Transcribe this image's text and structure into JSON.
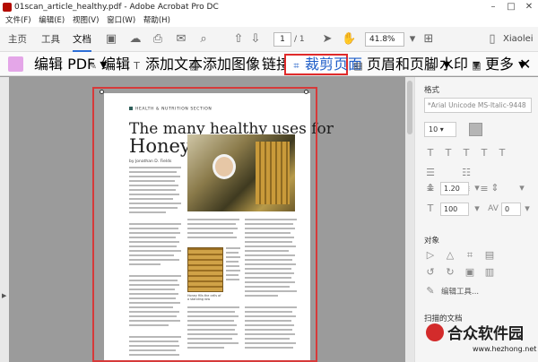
{
  "window": {
    "title": "01scan_article_healthy.pdf - Adobe Acrobat Pro DC"
  },
  "menu": [
    "文件(F)",
    "编辑(E)",
    "视图(V)",
    "窗口(W)",
    "帮助(H)"
  ],
  "toolbar": {
    "tabs": [
      "主页",
      "工具",
      "文档"
    ],
    "page_current": "1",
    "page_total": "/ 1",
    "zoom": "41.8%",
    "user": "Xiaolei"
  },
  "edit_toolbar": {
    "edit_pdf": "编辑 PDF",
    "edit": "编辑",
    "add_text": "添加文本",
    "add_image": "添加图像",
    "link": "链接",
    "crop": "裁剪页面",
    "header_footer": "页眉和页脚",
    "watermark": "水印",
    "more": "更多"
  },
  "document": {
    "section": "HEALTH & NUTRITION SECTION",
    "title_line1": "The many healthy uses for",
    "title_line2": "Honey",
    "byline": "by Jonathan D. Fields",
    "caption": "Honey fills the cells of a standing row"
  },
  "right_panel": {
    "format_label": "格式",
    "font": "*Arial Unicode MS-Italic-9448",
    "font_size": "10",
    "line_spacing": "1.20",
    "scale": "100",
    "char_spacing": "0",
    "objects_label": "对象",
    "edit_tools": "编辑工具...",
    "scanned_label": "扫描的文档"
  },
  "watermark": {
    "brand": "合众软件园",
    "url": "www.hezhong.net"
  }
}
